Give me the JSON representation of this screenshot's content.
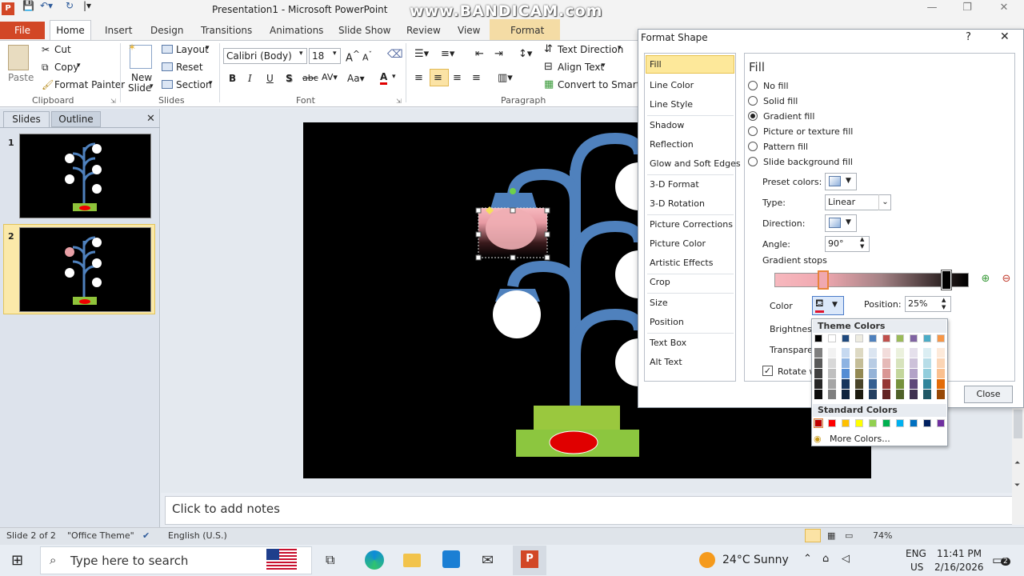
{
  "window": {
    "title": "Presentation1 - Microsoft PowerPoint",
    "watermark": "www.BANDICAM.com"
  },
  "tabs": [
    "File",
    "Home",
    "Insert",
    "Design",
    "Transitions",
    "Animations",
    "Slide Show",
    "Review",
    "View",
    "Format"
  ],
  "ribbon": {
    "clipboard": {
      "paste": "Paste",
      "cut": "Cut",
      "copy": "Copy",
      "format_painter": "Format Painter",
      "group": "Clipboard"
    },
    "slides": {
      "new_slide_1": "New",
      "new_slide_2": "Slide",
      "layout": "Layout",
      "reset": "Reset",
      "section": "Section",
      "group": "Slides"
    },
    "font": {
      "name": "Calibri (Body)",
      "size": "18",
      "group": "Font"
    },
    "paragraph": {
      "text_direction": "Text Direction",
      "align_text": "Align Text",
      "convert": "Convert to SmartArt",
      "group": "Paragraph"
    }
  },
  "left_panel": {
    "tab_slides": "Slides",
    "tab_outline": "Outline",
    "slide_numbers": [
      "1",
      "2"
    ]
  },
  "notes_placeholder": "Click to add notes",
  "status": {
    "slide": "Slide 2 of 2",
    "theme": "\"Office Theme\"",
    "language": "English (U.S.)",
    "zoom": "74%"
  },
  "taskbar": {
    "search_placeholder": "Type here to search",
    "weather": "24°C  Sunny",
    "lang_1": "ENG",
    "lang_2": "US",
    "time": "11:41 PM",
    "date": "2/16/2026",
    "notif_count": "2"
  },
  "dialog": {
    "title": "Format Shape",
    "help": "?",
    "nav": [
      "Fill",
      "Line Color",
      "Line Style",
      "Shadow",
      "Reflection",
      "Glow and Soft Edges",
      "3-D Format",
      "3-D Rotation",
      "Picture Corrections",
      "Picture Color",
      "Artistic Effects",
      "Crop",
      "Size",
      "Position",
      "Text Box",
      "Alt Text"
    ],
    "section_title": "Fill",
    "fill_options": [
      "No fill",
      "Solid fill",
      "Gradient fill",
      "Picture or texture fill",
      "Pattern fill",
      "Slide background fill"
    ],
    "selected_fill": "Gradient fill",
    "preset_label": "Preset colors:",
    "type_label": "Type:",
    "type_value": "Linear",
    "direction_label": "Direction:",
    "angle_label": "Angle:",
    "angle_value": "90°",
    "stops_label": "Gradient stops",
    "color_label": "Color",
    "position_label": "Position:",
    "position_value": "25%",
    "brightness_label": "Brightness",
    "transparency_label": "Transparen",
    "rotate_label": "Rotate w",
    "close_label": "Close"
  },
  "color_picker": {
    "theme_title": "Theme Colors",
    "standard_title": "Standard Colors",
    "more": "More Colors...",
    "theme_top": [
      "#000000",
      "#ffffff",
      "#1f497d",
      "#eeece1",
      "#4f81bd",
      "#c0504d",
      "#9bbb59",
      "#8064a2",
      "#4bacc6",
      "#f79646"
    ],
    "theme_shades": [
      [
        "#7f7f7f",
        "#f2f2f2",
        "#c6d9f0",
        "#ddd9c3",
        "#dbe5f1",
        "#f2dcdb",
        "#ebf1dd",
        "#e5e0ec",
        "#dbeef3",
        "#fdeada"
      ],
      [
        "#595959",
        "#d8d8d8",
        "#8db3e2",
        "#c4bd97",
        "#b8cce4",
        "#e5b9b7",
        "#d7e3bc",
        "#ccc1d9",
        "#b7dde8",
        "#fbd5b5"
      ],
      [
        "#3f3f3f",
        "#bfbfbf",
        "#548dd4",
        "#938953",
        "#95b3d7",
        "#d99694",
        "#c3d69b",
        "#b2a2c7",
        "#92cddc",
        "#fac08f"
      ],
      [
        "#262626",
        "#a5a5a5",
        "#17365d",
        "#494429",
        "#366092",
        "#953734",
        "#76923c",
        "#5f497a",
        "#31859b",
        "#e36c09"
      ],
      [
        "#0c0c0c",
        "#7f7f7f",
        "#0f243e",
        "#1d1b10",
        "#244061",
        "#632423",
        "#4f6128",
        "#3f3151",
        "#205867",
        "#974806"
      ]
    ],
    "standard": [
      "#c00000",
      "#ff0000",
      "#ffc000",
      "#ffff00",
      "#92d050",
      "#00b050",
      "#00b0f0",
      "#0070c0",
      "#002060",
      "#7030a0"
    ]
  }
}
